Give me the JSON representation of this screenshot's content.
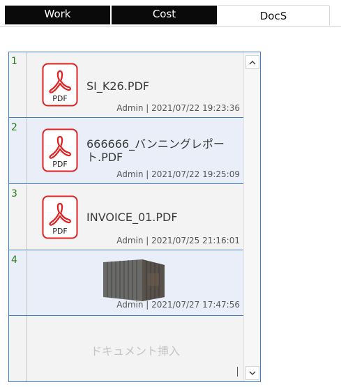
{
  "tabs": [
    {
      "label": "Work"
    },
    {
      "label": "Cost"
    },
    {
      "label": "DocS"
    }
  ],
  "documents": [
    {
      "index": "1",
      "type": "pdf",
      "icon": "pdf-icon",
      "name": "SI_K26.PDF",
      "meta": "Admin | 2021/07/22 19:23:36"
    },
    {
      "index": "2",
      "type": "pdf",
      "icon": "pdf-icon",
      "name": "666666_バンニングレポート.PDF",
      "meta": "Admin | 2021/07/22 19:25:09"
    },
    {
      "index": "3",
      "type": "pdf",
      "icon": "pdf-icon",
      "name": "INVOICE_01.PDF",
      "meta": "Admin | 2021/07/25 21:16:01"
    },
    {
      "index": "4",
      "type": "image",
      "icon": "container-photo",
      "name": "",
      "meta": "Admin | 2021/07/27 17:47:56"
    }
  ],
  "insert_label": "ドキュメント挿入",
  "colors": {
    "accent": "#3d7bd0",
    "index_text": "#2a7d1e",
    "pdf_red": "#e02020"
  }
}
